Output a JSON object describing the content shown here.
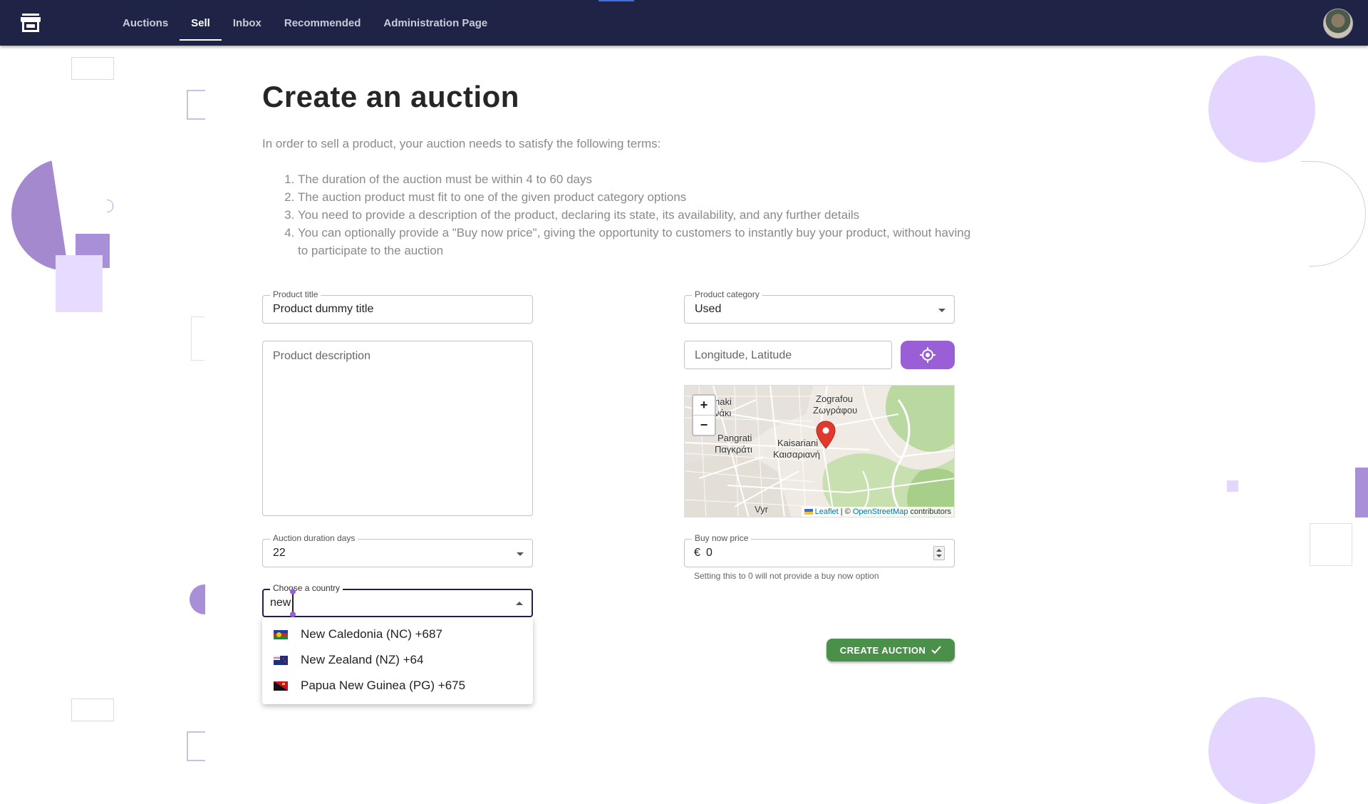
{
  "nav": {
    "tabs": [
      {
        "label": "Auctions",
        "active": false
      },
      {
        "label": "Sell",
        "active": true
      },
      {
        "label": "Inbox",
        "active": false
      },
      {
        "label": "Recommended",
        "active": false
      },
      {
        "label": "Administration Page",
        "active": false
      }
    ],
    "logo_icon": "store-icon",
    "avatar_icon": "user-avatar"
  },
  "page": {
    "title": "Create an auction",
    "intro": "In order to sell a product, your auction needs to satisfy the following terms:",
    "terms": [
      "The duration of the auction must be within 4 to 60 days",
      "The auction product must fit to one of the given product category options",
      "You need to provide a description of the product, declaring its state, its availability, and any further details",
      "You can optionally provide a \"Buy now price\", giving the opportunity to customers to instantly buy your product, without having to participate to the auction"
    ]
  },
  "form": {
    "product_title": {
      "label": "Product title",
      "value": "Product dummy title"
    },
    "product_category": {
      "label": "Product category",
      "value": "Used"
    },
    "description": {
      "placeholder": "Product description"
    },
    "location": {
      "placeholder": "Longitude, Latitude",
      "button_icon": "my-location-icon"
    },
    "duration": {
      "label": "Auction duration days",
      "value": "22"
    },
    "buy_now": {
      "label": "Buy now price",
      "currency": "€",
      "value": "0",
      "helper": "Setting this to 0 will not provide a buy now option"
    },
    "country": {
      "label": "Choose a country",
      "value": "new",
      "options": [
        {
          "text": "New Caledonia (NC) +687",
          "flag": "flag-nc"
        },
        {
          "text": "New Zealand (NZ) +64",
          "flag": "flag-nz"
        },
        {
          "text": "Papua New Guinea (PG) +675",
          "flag": "flag-pg"
        }
      ]
    },
    "create_button": "CREATE AUCTION"
  },
  "map": {
    "labels": {
      "zografou_en": "Zografou",
      "zografou_gr": "Ζωγράφου",
      "pangrati_en": "Pangrati",
      "pangrati_gr": "Παγκράτι",
      "kaisariani_en": "Kaisariani",
      "kaisariani_gr": "Καισαριανή",
      "naki_en": "naki",
      "naki_gr": "νάκι",
      "vyr": "Vyr"
    },
    "zoom_in": "+",
    "zoom_out": "−",
    "attribution": {
      "leaflet": "Leaflet",
      "separator": " | © ",
      "osm": "OpenStreetMap",
      "contributors": " contributors"
    }
  },
  "colors": {
    "nav_bg": "#1f2447",
    "accent_purple": "#9a5fd6",
    "create_green": "#4a8f4a",
    "pin_red": "#e03a2f"
  }
}
